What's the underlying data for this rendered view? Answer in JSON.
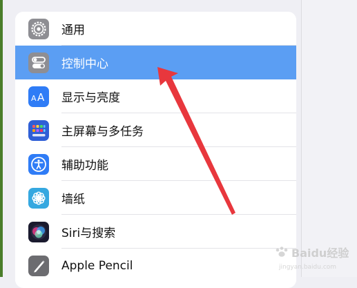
{
  "settings": {
    "items": [
      {
        "label": "通用",
        "icon": "gear-icon",
        "color": "#8e8e93"
      },
      {
        "label": "控制中心",
        "icon": "toggles-icon",
        "color": "#8e8e93",
        "selected": true
      },
      {
        "label": "显示与亮度",
        "icon": "text-size-icon",
        "color": "#2f7cf6"
      },
      {
        "label": "主屏幕与多任务",
        "icon": "app-grid-icon",
        "color": "#2f5fd6"
      },
      {
        "label": "辅助功能",
        "icon": "accessibility-icon",
        "color": "#2f7cf6"
      },
      {
        "label": "墙纸",
        "icon": "flower-icon",
        "color": "#35a8e0"
      },
      {
        "label": "Siri与搜索",
        "icon": "siri-icon",
        "color": "#1a1a2e"
      },
      {
        "label": "Apple Pencil",
        "icon": "pencil-icon",
        "color": "#6c6c70"
      }
    ],
    "selected_color": "#5b9ef3"
  },
  "annotation": {
    "arrow_color": "#e8373d"
  },
  "watermark": {
    "text": "Baidu经验",
    "url": "jingyan.baidu.com"
  }
}
